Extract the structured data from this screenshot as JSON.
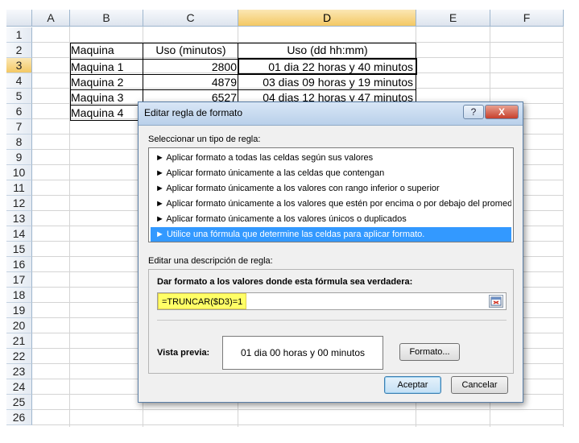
{
  "spreadsheet": {
    "columns": [
      "A",
      "B",
      "C",
      "D",
      "E",
      "F"
    ],
    "selected_column": "D",
    "rows": [
      "1",
      "2",
      "3",
      "4",
      "5",
      "6",
      "7",
      "8",
      "9",
      "10",
      "11",
      "12",
      "13",
      "14",
      "15",
      "16",
      "17",
      "18",
      "19",
      "20",
      "21",
      "22",
      "23",
      "24",
      "25",
      "26"
    ],
    "selected_row": "3",
    "header": {
      "b": "Maquina",
      "c": "Uso (minutos)",
      "d": "Uso (dd hh:mm)"
    },
    "data_rows": [
      {
        "b": "Maquina 1",
        "c": "2800",
        "d": "01 dia 22 horas y 40 minutos"
      },
      {
        "b": "Maquina 2",
        "c": "4879",
        "d": "03 dias 09 horas y 19 minutos"
      },
      {
        "b": "Maquina 3",
        "c": "6527",
        "d": "04 dias 12 horas y 47 minutos"
      },
      {
        "b": "Maquina 4",
        "c": "",
        "d": ""
      }
    ]
  },
  "dialog": {
    "title": "Editar regla de formato",
    "help_label": "?",
    "close_label": "X",
    "select_type_label": "Seleccionar un tipo de regla:",
    "rule_types": [
      "► Aplicar formato a todas las celdas según sus valores",
      "► Aplicar formato únicamente a las celdas que contengan",
      "► Aplicar formato únicamente a los valores con rango inferior o superior",
      "► Aplicar formato únicamente a los valores que estén por encima o por debajo del promedio",
      "► Aplicar formato únicamente a los valores únicos o duplicados",
      "► Utilice una fórmula que determine las celdas para aplicar formato."
    ],
    "selected_rule_index": 5,
    "edit_desc_label": "Editar una descripción de regla:",
    "formula_title": "Dar formato a los valores donde esta fórmula sea verdadera:",
    "formula_value": "=TRUNCAR($D3)=1",
    "preview_label": "Vista previa:",
    "preview_text": "01 dia 00 horas y 00 minutos",
    "format_button": "Formato...",
    "ok_button": "Aceptar",
    "cancel_button": "Cancelar"
  },
  "colors": {
    "selection_blue": "#3399ff",
    "formula_highlight": "#ffff66",
    "header_selected": "#f3c864"
  }
}
